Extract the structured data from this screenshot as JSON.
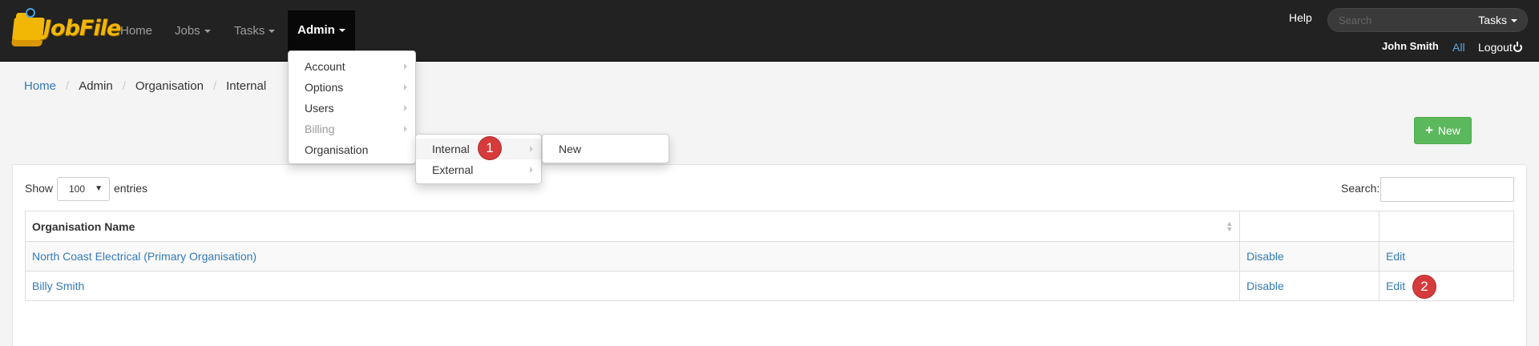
{
  "brand": {
    "name": "JobFile"
  },
  "nav": {
    "home": "Home",
    "jobs": "Jobs",
    "tasks": "Tasks",
    "admin": "Admin"
  },
  "header": {
    "help": "Help",
    "search_placeholder": "Search",
    "search_scope": "Tasks",
    "user": "John Smith",
    "all": "All",
    "logout": "Logout"
  },
  "admin_menu": {
    "items": [
      {
        "label": "Account",
        "disabled": false
      },
      {
        "label": "Options",
        "disabled": false
      },
      {
        "label": "Users",
        "disabled": false
      },
      {
        "label": "Billing",
        "disabled": true
      },
      {
        "label": "Organisation",
        "disabled": false
      }
    ]
  },
  "organisation_menu": {
    "items": [
      {
        "label": "Internal"
      },
      {
        "label": "External"
      }
    ]
  },
  "internal_menu": {
    "items": [
      {
        "label": "New"
      }
    ]
  },
  "breadcrumb": [
    "Home",
    "Admin",
    "Organisation",
    "Internal"
  ],
  "new_button": "New",
  "table_controls": {
    "show": "Show",
    "page_size": "100",
    "entries": "entries",
    "search": "Search:"
  },
  "table": {
    "columns": [
      "Organisation Name",
      "",
      ""
    ],
    "rows": [
      {
        "name": "North Coast Electrical (Primary Organisation)",
        "disable": "Disable",
        "edit": "Edit"
      },
      {
        "name": "Billy Smith",
        "disable": "Disable",
        "edit": "Edit"
      }
    ]
  },
  "annotations": {
    "badge1": "1",
    "badge2": "2"
  },
  "colors": {
    "navbar": "#222222",
    "link": "#337ab7",
    "success": "#5cb85c",
    "badge": "#d63b3b"
  }
}
